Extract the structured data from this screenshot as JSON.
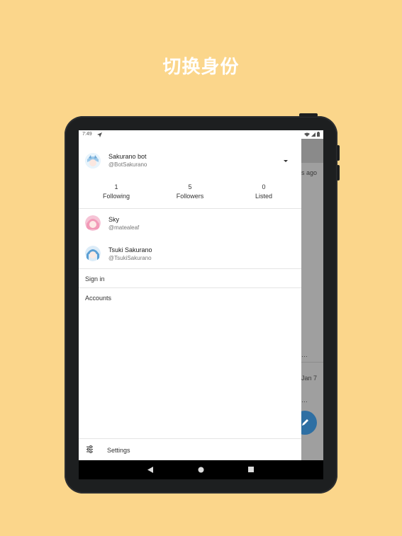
{
  "headline": "切换身份",
  "status_bar": {
    "time": "7:49"
  },
  "background_app": {
    "time_text_1": "s ago",
    "time_text_2": "Jan 7",
    "ellipsis_1": "…",
    "ellipsis_2": "…"
  },
  "current_account": {
    "name": "Sakurano bot",
    "handle": "@BotSakurano",
    "stats": [
      {
        "value": "1",
        "label": "Following"
      },
      {
        "value": "5",
        "label": "Followers"
      },
      {
        "value": "0",
        "label": "Listed"
      }
    ]
  },
  "other_accounts": [
    {
      "name": "Sky",
      "handle": "@matealeaf"
    },
    {
      "name": "Tsuki Sakurano",
      "handle": "@TsukiSakurano"
    }
  ],
  "menu": {
    "sign_in": "Sign in",
    "accounts": "Accounts",
    "settings": "Settings"
  },
  "colors": {
    "page_background": "#FBD68B",
    "fab": "#2E6FA3"
  }
}
